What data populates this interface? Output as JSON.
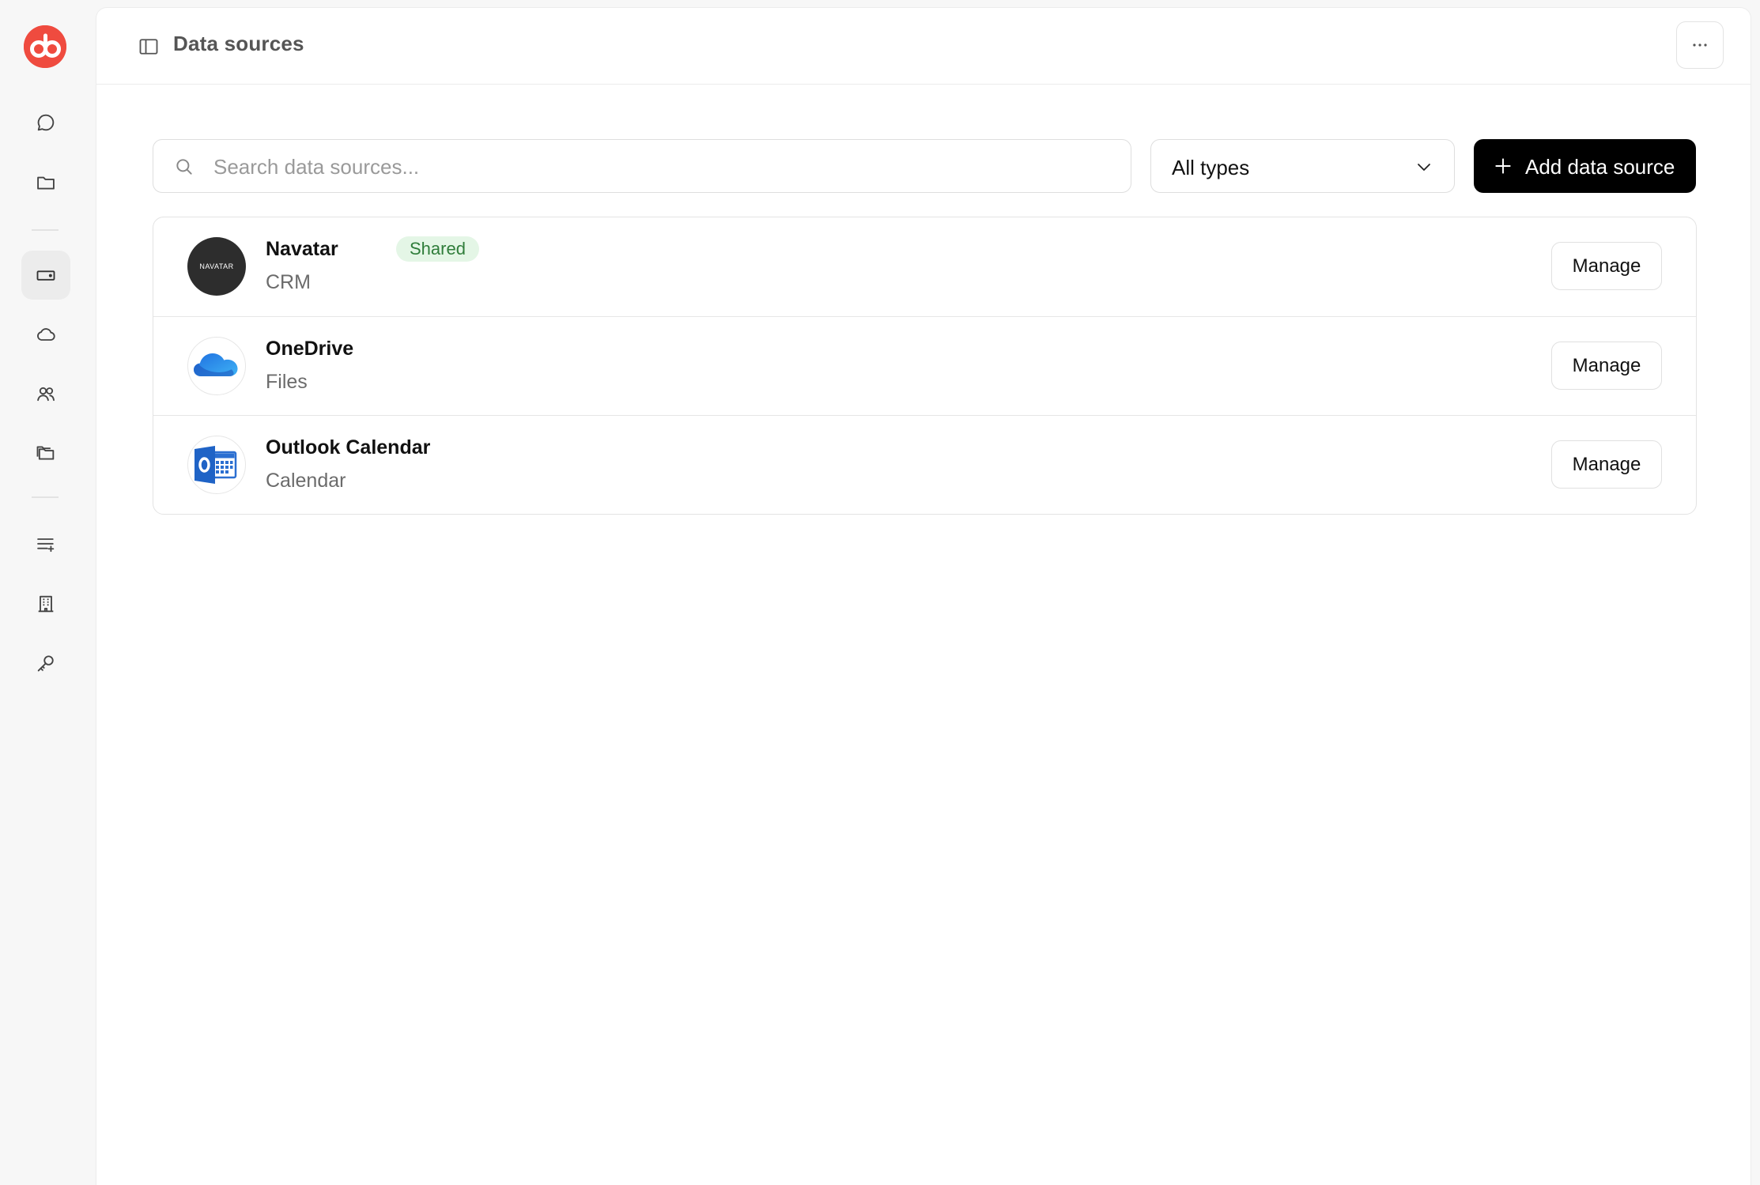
{
  "header": {
    "title": "Data sources"
  },
  "search": {
    "placeholder": "Search data sources..."
  },
  "filter": {
    "selected": "All types"
  },
  "add_button": {
    "label": "Add data source"
  },
  "sources": [
    {
      "name": "Navatar",
      "type": "CRM",
      "badge": "Shared",
      "logo_text": "NAVATAR",
      "action": "Manage"
    },
    {
      "name": "OneDrive",
      "type": "Files",
      "action": "Manage"
    },
    {
      "name": "Outlook Calendar",
      "type": "Calendar",
      "action": "Manage"
    }
  ],
  "colors": {
    "brand": "#ef4b3f",
    "badge_bg": "#e4f6e6",
    "badge_text": "#2f7d3a",
    "primary_button": "#000000"
  },
  "rail_icons": [
    "chat-icon",
    "folder-icon",
    "data-sources-icon",
    "cloud-icon",
    "users-icon",
    "files-icon",
    "list-add-icon",
    "building-icon",
    "key-icon"
  ]
}
